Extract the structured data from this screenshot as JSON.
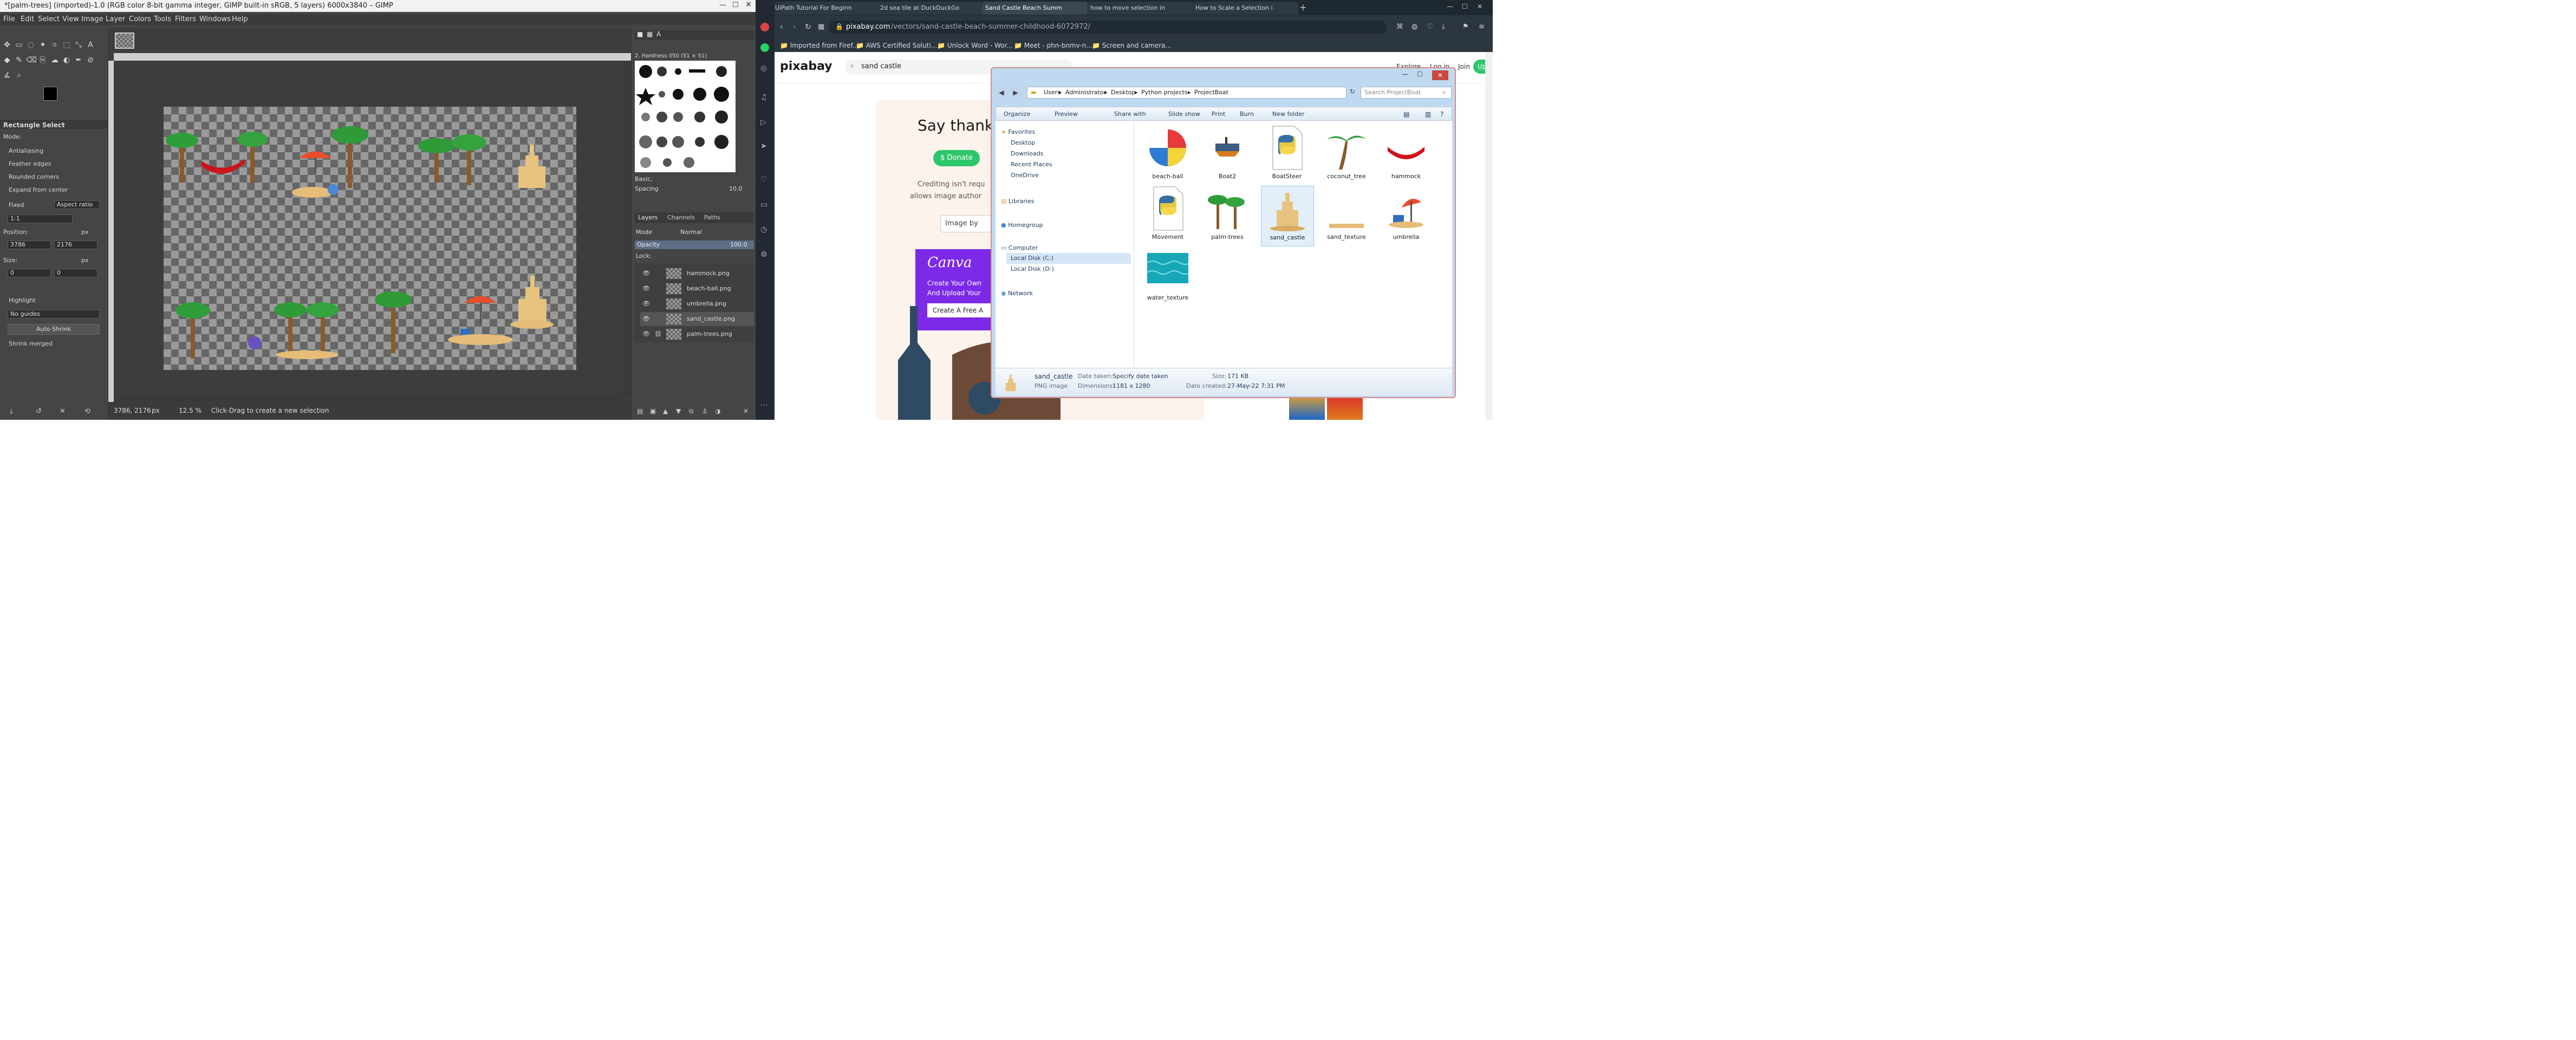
{
  "gimp": {
    "title": "*[palm-trees] (imported)-1.0 (RGB color 8-bit gamma integer, GIMP built-in sRGB, 5 layers) 6000x3840 – GIMP",
    "menu": [
      "File",
      "Edit",
      "Select",
      "View",
      "Image",
      "Layer",
      "Colors",
      "Tools",
      "Filters",
      "Windows",
      "Help"
    ],
    "tool_options": {
      "title": "Rectangle Select",
      "mode_label": "Mode:",
      "antialiasing": "Antialiasing",
      "feather_edges": "Feather edges",
      "rounded_corners": "Rounded corners",
      "expand_from_center": "Expand from center",
      "fixed_label": "Fixed",
      "fixed_value": "Aspect ratio",
      "ratio_value": "1:1",
      "position_label": "Position:",
      "position_unit": "px",
      "position_x": "3786",
      "position_y": "2176",
      "size_label": "Size:",
      "size_unit": "px",
      "size_w": "0",
      "size_h": "0",
      "highlight": "Highlight",
      "guides": "No guides",
      "auto_shrink": "Auto Shrink",
      "shrink_merged": "Shrink merged"
    },
    "status": {
      "coords": "3786, 2176",
      "unit": "px",
      "zoom": "12.5 %",
      "message": "Click-Drag to create a new selection"
    },
    "brushes": {
      "header": "2. Hardness 050 (51 × 51)",
      "basic_label": "Basic,",
      "spacing_label": "Spacing",
      "spacing_value": "10.0"
    },
    "layers": {
      "tabs": [
        "Layers",
        "Channels",
        "Paths"
      ],
      "mode_label": "Mode",
      "mode_value": "Normal",
      "opacity_label": "Opacity",
      "opacity_value": "100.0",
      "lock_label": "Lock:",
      "items": [
        "hammock.png",
        "beach-ball.png",
        "umbrella.png",
        "sand_castle.png",
        "palm-trees.png"
      ]
    }
  },
  "browser": {
    "tabs": [
      {
        "label": "UiPath Tutorial For Beginn",
        "active": false
      },
      {
        "label": "2d sea tile at DuckDuckGo",
        "active": false
      },
      {
        "label": "Sand Castle Beach Summ",
        "active": true
      },
      {
        "label": "how to move selection in",
        "active": false
      },
      {
        "label": "How to Scale a Selection i",
        "active": false
      }
    ],
    "url_host": "pixabay.com",
    "url_path": "/vectors/sand-castle-beach-summer-childhood-6072972/",
    "bookmarks": [
      "Imported from Firef...",
      "AWS Certified Soluti...",
      "Unlock Word - Wor...",
      "Meet - phn-bnmv-n...",
      "Screen and camera..."
    ],
    "site": {
      "logo": "pixabay",
      "search_value": "sand castle",
      "nav": [
        "Explore",
        "Log in",
        "Join"
      ],
      "upload": "Upload",
      "say_thanks": "Say thank",
      "donate": "$ Donate",
      "crediting_1": "Crediting isn't requ",
      "crediting_2": "allows image author",
      "image_by": "Image by",
      "canva_logo": "Canva",
      "canva_line1": "Create Your Own",
      "canva_line2": "And Upload Your",
      "canva_btn": "Create A Free A"
    }
  },
  "explorer": {
    "breadcrumb": [
      "Users",
      "Administrator",
      "Desktop",
      "Python projects",
      "ProjectBoat"
    ],
    "search_placeholder": "Search ProjectBoat",
    "toolbar": [
      "Organize",
      "Preview",
      "Share with",
      "Slide show",
      "Print",
      "Burn",
      "New folder"
    ],
    "nav": {
      "favorites": "Favorites",
      "fav_items": [
        "Desktop",
        "Downloads",
        "Recent Places",
        "OneDrive"
      ],
      "libraries": "Libraries",
      "homegroup": "Homegroup",
      "computer": "Computer",
      "drives": [
        "Local Disk (C:)",
        "Local Disk (D:)"
      ],
      "network": "Network"
    },
    "files": [
      "beach-ball",
      "Boat2",
      "BoatSteer",
      "coconut_tree",
      "hammock",
      "Movement",
      "palm-trees",
      "sand_castle",
      "sand_texture",
      "umbrella",
      "water_texture"
    ],
    "details": {
      "name": "sand_castle",
      "type": "PNG image",
      "date_taken_label": "Date taken:",
      "date_taken_value": "Specify date taken",
      "dimensions_label": "Dimensions:",
      "dimensions_value": "1181 x 1280",
      "size_label": "Size:",
      "size_value": "171 KB",
      "date_created_label": "Date created:",
      "date_created_value": "27-May-22 7:31 PM"
    }
  }
}
